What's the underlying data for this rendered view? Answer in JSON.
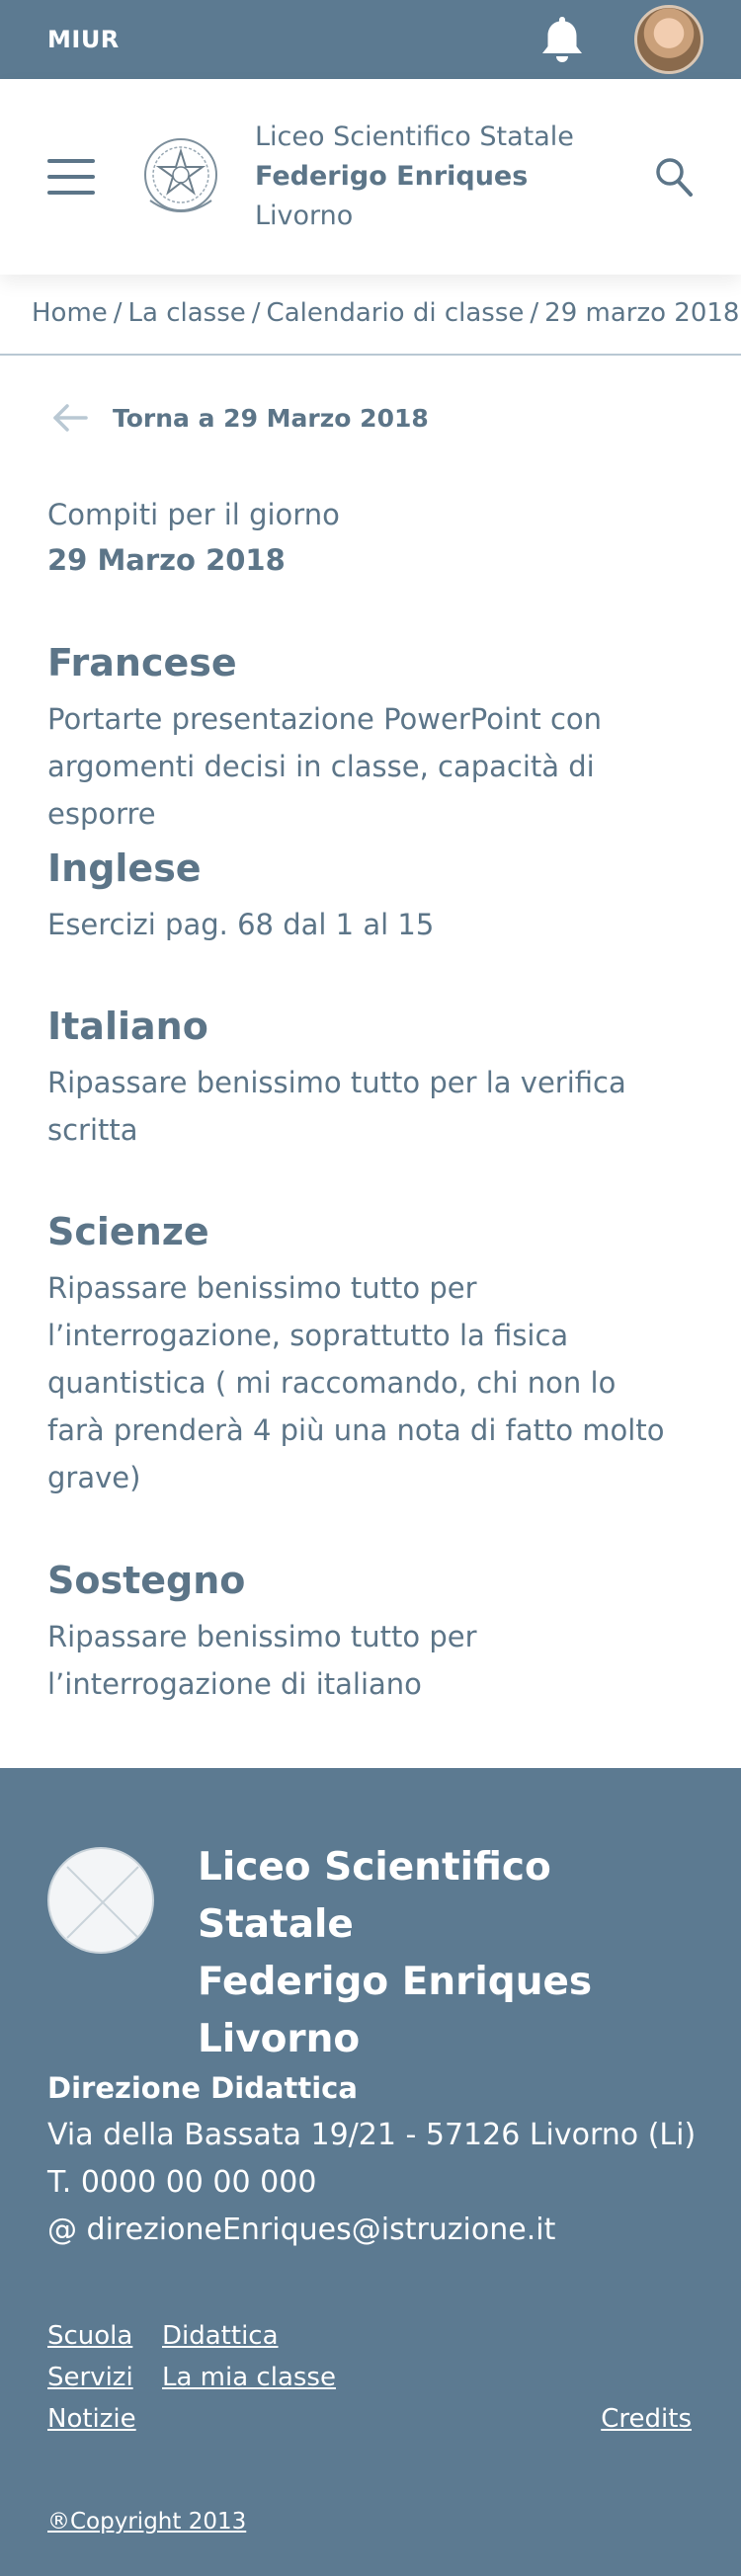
{
  "topbar": {
    "brand": "MIUR",
    "bell_icon": "bell-icon",
    "avatar_icon": "user-avatar"
  },
  "header": {
    "menu_icon": "hamburger-icon",
    "emblem_icon": "republic-emblem-icon",
    "line1": "Liceo Scientifico Statale",
    "line2": "Federigo Enriques",
    "line3": "Livorno",
    "search_icon": "search-icon"
  },
  "breadcrumb": {
    "items": [
      "Home",
      "La classe",
      "Calendario di classe",
      "29 marzo 2018"
    ],
    "separator": "/"
  },
  "back": {
    "label": "Torna a 29 Marzo 2018",
    "icon": "arrow-left-icon"
  },
  "intro": {
    "label": "Compiti per il giorno",
    "date": "29 Marzo 2018"
  },
  "subjects": [
    {
      "name": "Francese",
      "task_lines": [
        "Portarte presentazione PowerPoint con",
        "argomenti decisi in classe, capacità di esporre"
      ]
    },
    {
      "name": "Inglese",
      "task_lines": [
        "Esercizi pag. 68 dal 1 al 15"
      ]
    },
    {
      "name": "Italiano",
      "task_lines": [
        "Ripassare benissimo tutto per la verifica",
        "scritta"
      ]
    },
    {
      "name": "Scienze",
      "task_lines": [
        "Ripassare benissimo tutto per",
        "l’interrogazione, soprattutto la fisica",
        "quantistica ( mi raccomando, chi non lo",
        "farà prenderà 4 più una nota di fatto molto",
        "grave)"
      ]
    },
    {
      "name": "Sostegno",
      "task_lines": [
        "Ripassare benissimo tutto per",
        "l’interrogazione di italiano"
      ]
    }
  ],
  "footer": {
    "logo_icon": "placeholder-logo-icon",
    "title_line1": "Liceo Scientifico Statale",
    "title_line2": "Federigo Enriques",
    "title_line3": "Livorno",
    "office": "Direzione Didattica",
    "address": "Via della Bassata 19/21 - 57126 Livorno (Li)",
    "phone": "T. 0000 00 00 000",
    "email": "@ direzioneEnriques@istruzione.it",
    "links": {
      "scuola": "Scuola",
      "didattica": "Didattica",
      "servizi": "Servizi",
      "la_mia_classe": "La mia classe",
      "notizie": "Notizie",
      "credits": "Credits"
    },
    "copyright": "®Copyright 2013"
  },
  "colors": {
    "primary": "#5c7a91",
    "text": "#5c7588",
    "divider": "#b9c8d3"
  }
}
